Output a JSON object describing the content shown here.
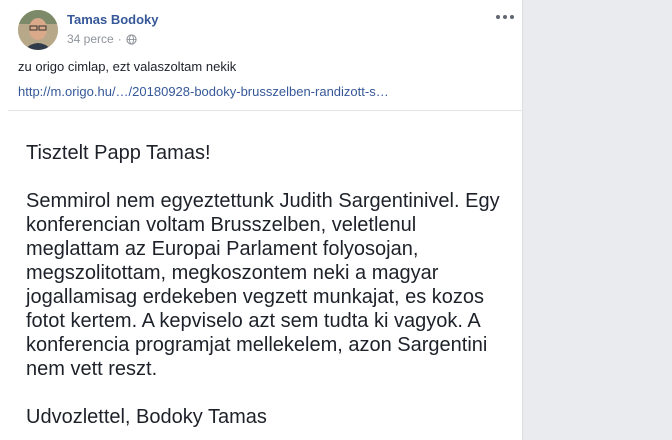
{
  "post": {
    "author": "Tamas Bodoky",
    "time": "34 perce",
    "privacy_icon": "globe-icon",
    "menu_icon": "more-options-icon",
    "text": "zu origo cimlap, ezt valaszoltam nekik",
    "link": "http://m.origo.hu/…/20180928-bodoky-brusszelben-randizott-s…"
  },
  "letter": {
    "greeting": "Tisztelt Papp Tamas!",
    "lines": [
      "Semmirol nem egyeztettunk Judith Sargentinivel. Egy",
      "konferencian voltam Brusszelben, veletlenul",
      "meglattam az Europai Parlament folyosojan,",
      "megszolitottam, megkoszontem neki a magyar",
      "jogallamisag erdekeben vegzett munkajat, es kozos",
      "fotot kertem. A kepviselo azt sem tudta ki vagyok. A",
      "konferencia programjat mellekelem, azon Sargentini",
      "nem vett reszt."
    ],
    "closing": "Udvozlettel, Bodoky Tamas"
  }
}
